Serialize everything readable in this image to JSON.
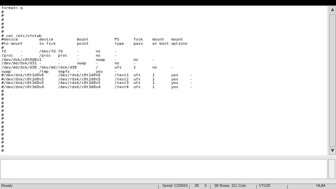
{
  "terminal": {
    "lines": [
      "format> q",
      "#",
      "#",
      "#",
      "#",
      "#",
      "#",
      "# cat /etc/vfstab",
      "#device         device          mount           FS      fsck    mount   mount",
      "#to mount       to fsck         point           type    pass    at boot options",
      "#",
      "fd      -       /dev/fd fd      -       no      -",
      "/proc   -       /proc   proc    -       no      -",
      "/dev/dsk/c0t0d0s1       -       -       swap    -       no      -",
      "/dev/md/dsk/d31 -       -       swap    -       no      -",
      "/dev/md/dsk/d30 /dev/md/rdsk/d30        /       ufs     1       no      -",
      "swap    -       /tmp    tmpfs   -       yes     -",
      "#/dev/dsk/c0t1d0s6      /dev/rdsk/c0t1d0s6      /test1  ufs     1       yes     -",
      "#/dev/dsk/c0t2d0s5      /dev/rdsk/c0t2d0s5      /test2  ufs     1       yes     -",
      "#/dev/dsk/c0t3d0s5      /dev/rdsk/c0t3d0s5      /test3  ufs     1       yes     -",
      "#/dev/dsk/c0t3d0s4      /dev/rdsk/c0t3d0s4      /test4  ufs     1       yes     -",
      "#",
      "#",
      "#",
      "#",
      "#",
      "#",
      "#",
      "#",
      "#",
      "#",
      "#",
      "#",
      "#",
      "#",
      "#",
      "#"
    ]
  },
  "statusbar": {
    "ready": "Ready",
    "connection": "Serial: COM16",
    "row": "35",
    "col": "3",
    "size": "38 Rows, 111 Cols",
    "emulation": "VT100",
    "num": "NUM"
  }
}
